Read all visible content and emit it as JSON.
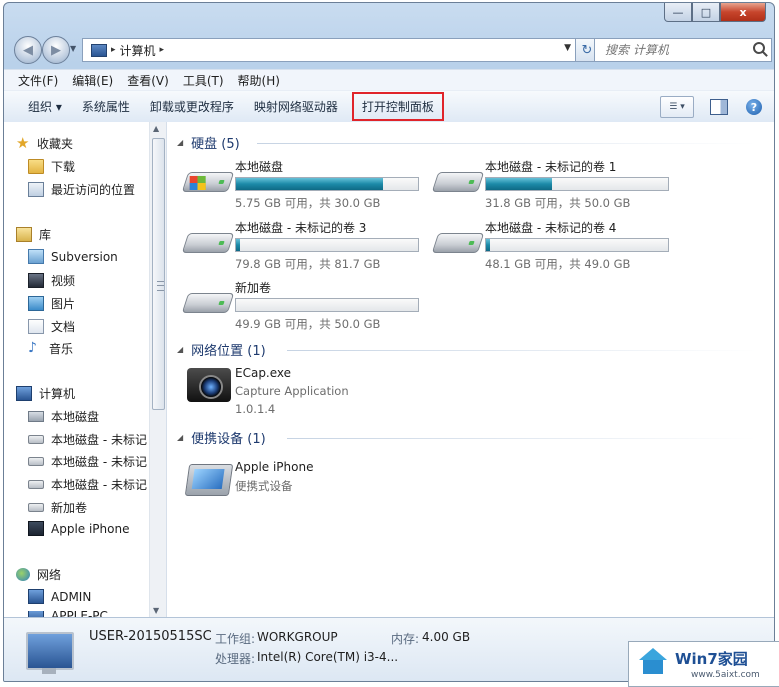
{
  "window": {
    "caption_minimize": "—",
    "caption_maximize": "□",
    "caption_close": "x"
  },
  "nav": {
    "back_glyph": "◀",
    "forward_glyph": "▶",
    "address_parts": [
      "计算机"
    ],
    "address_sep": "▸",
    "refresh_glyph": "↻",
    "search_placeholder": "搜索 计算机"
  },
  "menubar": {
    "items": [
      "文件(F)",
      "编辑(E)",
      "查看(V)",
      "工具(T)",
      "帮助(H)"
    ]
  },
  "toolbar": {
    "organize": "组织 ▾",
    "system_properties": "系统属性",
    "uninstall": "卸载或更改程序",
    "map_drive": "映射网络驱动器",
    "open_control_panel": "打开控制面板",
    "help_glyph": "?"
  },
  "navpane": {
    "favorites": "收藏夹",
    "downloads": "下载",
    "recent": "最近访问的位置",
    "libraries": "库",
    "subversion": "Subversion",
    "videos": "视频",
    "pictures": "图片",
    "documents": "文档",
    "music": "音乐",
    "computer": "计算机",
    "local_disk": "本地磁盘",
    "unlabeled_1": "本地磁盘 - 未标记",
    "unlabeled_2": "本地磁盘 - 未标记",
    "unlabeled_3": "本地磁盘 - 未标记",
    "new_volume": "新加卷",
    "apple_iphone": "Apple iPhone",
    "network": "网络",
    "admin": "ADMIN",
    "apple_pc": "APPLE-PC"
  },
  "content": {
    "groups": {
      "hdd": "硬盘 (5)",
      "network": "网络位置 (1)",
      "portable": "便携设备 (1)"
    },
    "drives": [
      {
        "name": "本地磁盘",
        "space": "5.75 GB 可用，共 30.0 GB",
        "used_fraction": 0.81
      },
      {
        "name": "本地磁盘 - 未标记的卷 1",
        "space": "31.8 GB 可用，共 50.0 GB",
        "used_fraction": 0.36
      },
      {
        "name": "本地磁盘 - 未标记的卷 3",
        "space": "79.8 GB 可用，共 81.7 GB",
        "used_fraction": 0.02
      },
      {
        "name": "本地磁盘 - 未标记的卷 4",
        "space": "48.1 GB 可用，共 49.0 GB",
        "used_fraction": 0.02
      },
      {
        "name": "新加卷",
        "space": "49.9 GB 可用，共 50.0 GB",
        "used_fraction": 0.0
      }
    ],
    "network_item": {
      "name": "ECap.exe",
      "desc": "Capture Application",
      "version": "1.0.1.4"
    },
    "portable_item": {
      "name": "Apple iPhone",
      "desc": "便携式设备"
    }
  },
  "details": {
    "computer_name": "USER-20150515SC",
    "workgroup_label": "工作组:",
    "workgroup": "WORKGROUP",
    "memory_label": "内存:",
    "memory": "4.00 GB",
    "processor_label": "处理器:",
    "processor": "Intel(R) Core(TM) i3-4..."
  },
  "watermark": {
    "title": "Win7家园",
    "url": "www.5aixt.com"
  },
  "colors": {
    "accent": "#1e3a6e",
    "highlight_box": "#e0242a",
    "bar_fill": "#1c8aa8"
  }
}
